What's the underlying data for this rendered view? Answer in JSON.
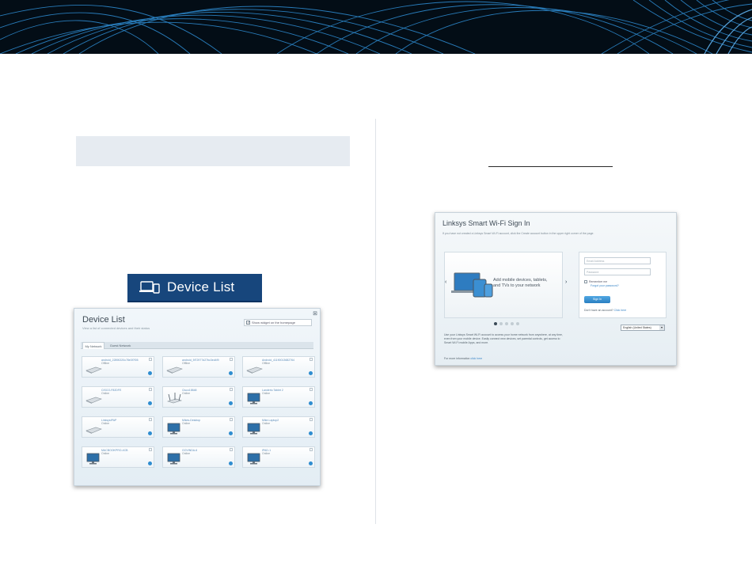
{
  "device_list_banner": {
    "label": "Device List"
  },
  "device_list_screenshot": {
    "title": "Device List",
    "subtitle": "View a list of connected devices and their status",
    "widget_label": "Show widget on the homepage",
    "tabs": [
      "My Network",
      "Guest Network"
    ],
    "devices": [
      {
        "name": "android_22890220c78e3f7f05",
        "status": "Offline",
        "icon": "laptop-icon"
      },
      {
        "name": "android_5f72977d27bc3ed4f9",
        "status": "Offline",
        "icon": "laptop-icon"
      },
      {
        "name": "Android_41190013682764",
        "status": "Offline",
        "icon": "laptop-icon"
      },
      {
        "name": "CISCO-F82DFE",
        "status": "Online",
        "icon": "laptop-icon"
      },
      {
        "name": "Cisco15848",
        "status": "Online",
        "icon": "router-icon"
      },
      {
        "name": "Landerlu Tablet 2",
        "status": "Online",
        "icon": "desktop-icon"
      },
      {
        "name": "LinksysIPAP",
        "status": "Online",
        "icon": "laptop-icon"
      },
      {
        "name": "Mikes-Desktop",
        "status": "Online",
        "icon": "desktop-icon"
      },
      {
        "name": "Mike-Laptop2",
        "status": "Online",
        "icon": "desktop-icon"
      },
      {
        "name": "MACBOOKPRO-4CB",
        "status": "Online",
        "icon": "desktop-icon"
      },
      {
        "name": "GOVINDA-6",
        "status": "Online",
        "icon": "desktop-icon"
      },
      {
        "name": "IPAD-1",
        "status": "Online",
        "icon": "desktop-icon"
      }
    ]
  },
  "signin_screenshot": {
    "title": "Linksys Smart Wi-Fi Sign In",
    "subtitle": "If you have not created a Linksys Smart Wi-Fi account, click the Create account button in the upper right corner of the page.",
    "carousel_text": "Add mobile devices, tablets, and TVs to your network",
    "description": "Use your Linksys Smart Wi-Fi account to access your home network from anywhere, at any time, even from your mobile device. Easily connect new devices, set parental controls, get access to Smart Wi-Fi mobile Apps, and more.",
    "more_info_prefix": "For more information",
    "more_info_link": "click here",
    "email_placeholder": "Email Address",
    "password_placeholder": "Password",
    "remember_me": "Remember me",
    "forgot_password": "Forgot your password?",
    "sign_in_button": "Sign In",
    "no_account_prefix": "Don't have an account?",
    "no_account_link": "Click here",
    "language": "English (United States)"
  }
}
